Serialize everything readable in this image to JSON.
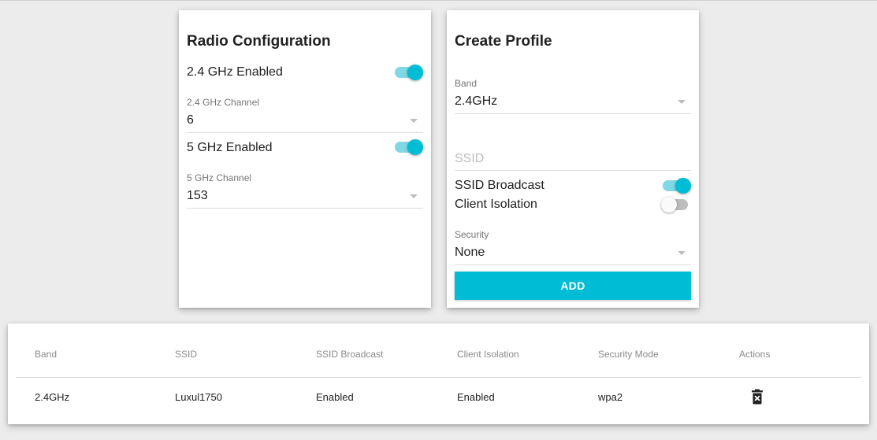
{
  "radio": {
    "title": "Radio Configuration",
    "band24": {
      "enabled_label": "2.4 GHz Enabled",
      "enabled": true,
      "channel_label": "2.4 GHz Channel",
      "channel_value": "6"
    },
    "band5": {
      "enabled_label": "5 GHz Enabled",
      "enabled": true,
      "channel_label": "5 GHz Channel",
      "channel_value": "153"
    }
  },
  "profile": {
    "title": "Create Profile",
    "band_label": "Band",
    "band_value": "2.4GHz",
    "ssid_placeholder": "SSID",
    "ssid_broadcast_label": "SSID Broadcast",
    "ssid_broadcast": true,
    "client_isolation_label": "Client Isolation",
    "client_isolation": false,
    "security_label": "Security",
    "security_value": "None",
    "add_label": "ADD"
  },
  "table": {
    "headers": [
      "Band",
      "SSID",
      "SSID Broadcast",
      "Client Isolation",
      "Security Mode",
      "Actions"
    ],
    "rows": [
      {
        "band": "2.4GHz",
        "ssid": "Luxul1750",
        "ssid_broadcast": "Enabled",
        "client_isolation": "Enabled",
        "security_mode": "wpa2",
        "action_icon": "delete-icon"
      }
    ]
  },
  "colors": {
    "accent": "#00bcd4",
    "accent_track": "#7fd8e4",
    "background": "#ececec"
  }
}
